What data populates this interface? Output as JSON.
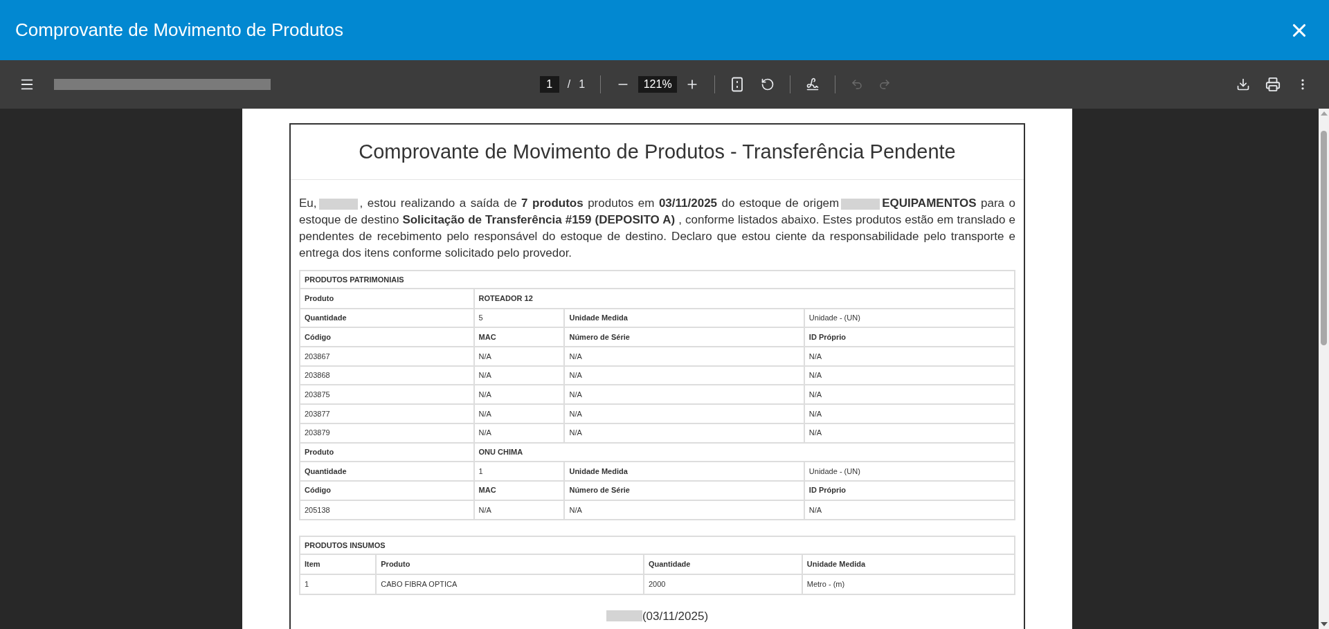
{
  "window": {
    "title": "Comprovante de Movimento de Produtos"
  },
  "toolbar": {
    "page_input": "1",
    "page_separator": "/",
    "page_total": "1",
    "zoom": "121%",
    "undo": {
      "disabled": true
    },
    "redo": {
      "disabled": true
    }
  },
  "document": {
    "title": "Comprovante de Movimento de Produtos - Transferência Pendente",
    "paragraph": [
      {
        "kind": "text",
        "text": "Eu,"
      },
      {
        "kind": "redacted"
      },
      {
        "kind": "text",
        "text": ", estou realizando a saída de **7 produtos** produtos em **03/11/2025** do estoque de origem"
      },
      {
        "kind": "redacted"
      },
      {
        "kind": "text",
        "text": "**EQUIPAMENTOS** para o estoque de destino **Solicitação de Transferência #159 (DEPOSITO A)** , conforme listados abaixo. Estes produtos estão em translado e pendentes de recebimento pelo responsável do estoque de destino. Declaro que estou ciente da responsabilidade pelo transporte e entrega dos itens conforme solicitado pelo provedor."
      }
    ],
    "tables": [
      {
        "title": "PRODUTOS PATRIMONIAIS",
        "rows": [
          {
            "cells": [
              {
                "text": "Produto",
                "bold": true
              },
              {
                "text": "ROTEADOR 12",
                "bold": true,
                "colspan": 3
              }
            ]
          },
          {
            "cells": [
              {
                "text": "Quantidade",
                "bold": true
              },
              {
                "text": "5",
                "bold": false
              },
              {
                "text": "Unidade Medida",
                "bold": true
              },
              {
                "text": "Unidade - (UN)",
                "bold": false
              }
            ]
          },
          {
            "cells": [
              {
                "text": "Código",
                "bold": true
              },
              {
                "text": "MAC",
                "bold": true
              },
              {
                "text": "Número de Série",
                "bold": true
              },
              {
                "text": "ID Próprio",
                "bold": true
              }
            ]
          },
          {
            "cells": [
              {
                "text": "203867",
                "bold": false
              },
              {
                "text": "N/A",
                "bold": false
              },
              {
                "text": "N/A",
                "bold": false
              },
              {
                "text": "N/A",
                "bold": false
              }
            ]
          },
          {
            "cells": [
              {
                "text": "203868",
                "bold": false
              },
              {
                "text": "N/A",
                "bold": false
              },
              {
                "text": "N/A",
                "bold": false
              },
              {
                "text": "N/A",
                "bold": false
              }
            ]
          },
          {
            "cells": [
              {
                "text": "203875",
                "bold": false
              },
              {
                "text": "N/A",
                "bold": false
              },
              {
                "text": "N/A",
                "bold": false
              },
              {
                "text": "N/A",
                "bold": false
              }
            ]
          },
          {
            "cells": [
              {
                "text": "203877",
                "bold": false
              },
              {
                "text": "N/A",
                "bold": false
              },
              {
                "text": "N/A",
                "bold": false
              },
              {
                "text": "N/A",
                "bold": false
              }
            ]
          },
          {
            "cells": [
              {
                "text": "203879",
                "bold": false
              },
              {
                "text": "N/A",
                "bold": false
              },
              {
                "text": "N/A",
                "bold": false
              },
              {
                "text": "N/A",
                "bold": false
              }
            ]
          },
          {
            "cells": [
              {
                "text": "Produto",
                "bold": true
              },
              {
                "text": "ONU CHIMA",
                "bold": true,
                "colspan": 3
              }
            ]
          },
          {
            "cells": [
              {
                "text": "Quantidade",
                "bold": true
              },
              {
                "text": "1",
                "bold": false
              },
              {
                "text": "Unidade Medida",
                "bold": true
              },
              {
                "text": "Unidade - (UN)",
                "bold": false
              }
            ]
          },
          {
            "cells": [
              {
                "text": "Código",
                "bold": true
              },
              {
                "text": "MAC",
                "bold": true
              },
              {
                "text": "Número de Série",
                "bold": true
              },
              {
                "text": "ID Próprio",
                "bold": true
              }
            ]
          },
          {
            "cells": [
              {
                "text": "205138",
                "bold": false
              },
              {
                "text": "N/A",
                "bold": false
              },
              {
                "text": "N/A",
                "bold": false
              },
              {
                "text": "N/A",
                "bold": false
              }
            ]
          }
        ]
      },
      {
        "title": "PRODUTOS INSUMOS",
        "rows": [
          {
            "cells": [
              {
                "text": "Item",
                "bold": true
              },
              {
                "text": "Produto",
                "bold": true
              },
              {
                "text": "Quantidade",
                "bold": true
              },
              {
                "text": "Unidade Medida",
                "bold": true
              }
            ]
          },
          {
            "cells": [
              {
                "text": "1",
                "bold": false
              },
              {
                "text": "CABO FIBRA OPTICA",
                "bold": false
              },
              {
                "text": "2000",
                "bold": false
              },
              {
                "text": "Metro - (m)",
                "bold": false
              }
            ]
          }
        ]
      }
    ],
    "signature_date": "(03/11/2025)"
  }
}
